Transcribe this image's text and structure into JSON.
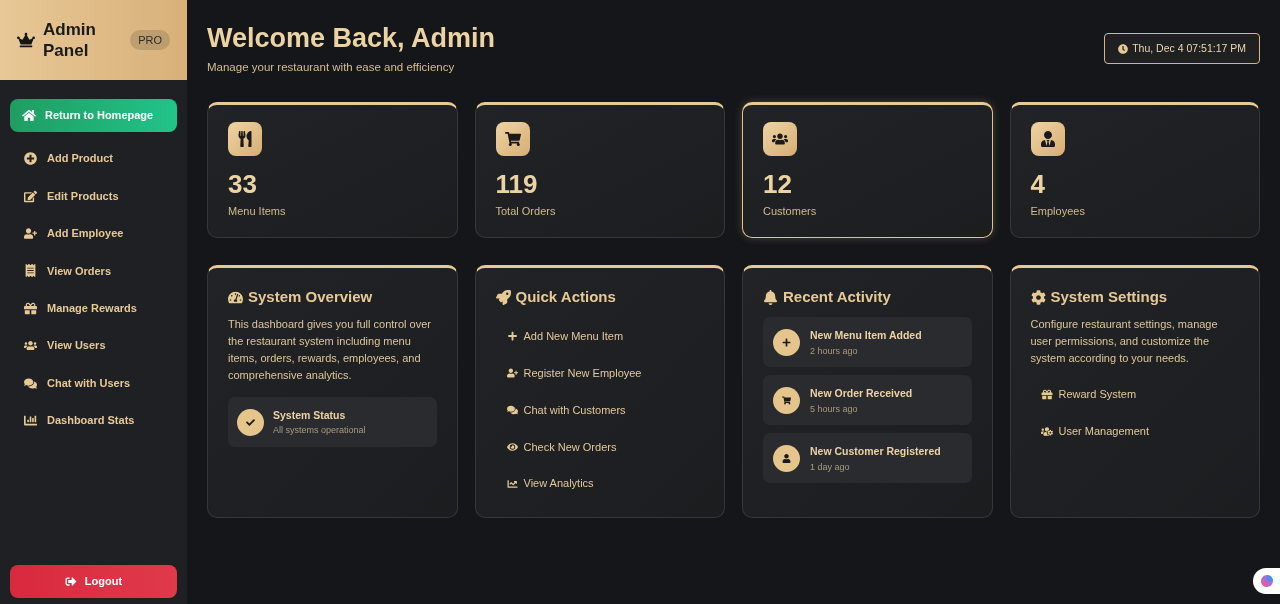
{
  "sidebar": {
    "title": "Admin Panel",
    "badge": "PRO",
    "home_button": "Return to Homepage",
    "items": [
      "Add Product",
      "Edit Products",
      "Add Employee",
      "View Orders",
      "Manage Rewards",
      "View Users",
      "Chat with Users",
      "Dashboard Stats"
    ],
    "logout_button": "Logout"
  },
  "header": {
    "title": "Welcome Back, Admin",
    "subtitle": "Manage your restaurant with ease and efficiency",
    "datetime": "Thu, Dec 4 07:51:17 PM"
  },
  "stats": [
    {
      "value": "33",
      "label": "Menu Items",
      "highlighted": false
    },
    {
      "value": "119",
      "label": "Total Orders",
      "highlighted": false
    },
    {
      "value": "12",
      "label": "Customers",
      "highlighted": true
    },
    {
      "value": "4",
      "label": "Employees",
      "highlighted": false
    }
  ],
  "system_overview": {
    "title": "System Overview",
    "text": "This dashboard gives you full control over the restaurant system including menu items, orders, rewards, employees, and comprehensive analytics.",
    "status": {
      "title": "System Status",
      "subtitle": "All systems operational"
    }
  },
  "quick_actions": {
    "title": "Quick Actions",
    "items": [
      "Add New Menu Item",
      "Register New Employee",
      "Chat with Customers",
      "Check New Orders",
      "View Analytics"
    ]
  },
  "recent_activity": {
    "title": "Recent Activity",
    "items": [
      {
        "title": "New Menu Item Added",
        "time": "2 hours ago"
      },
      {
        "title": "New Order Received",
        "time": "5 hours ago"
      },
      {
        "title": "New Customer Registered",
        "time": "1 day ago"
      }
    ]
  },
  "system_settings": {
    "title": "System Settings",
    "text": "Configure restaurant settings, manage user permissions, and customize the system according to your needs.",
    "items": [
      "Reward System",
      "User Management"
    ]
  }
}
